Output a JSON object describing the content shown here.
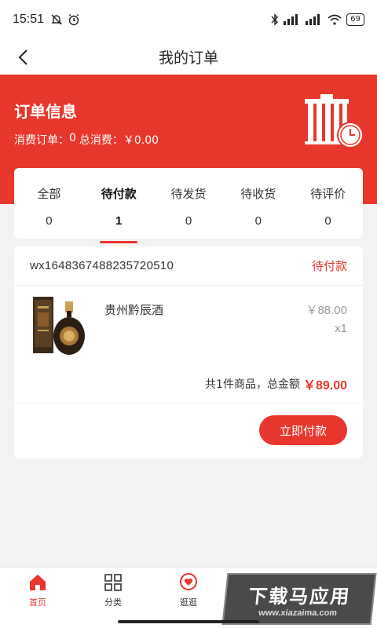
{
  "status_bar": {
    "time": "15:51",
    "battery": "69"
  },
  "nav": {
    "title": "我的订单"
  },
  "header": {
    "title": "订单信息",
    "orders_label": "消费订单：",
    "orders_count": "0",
    "total_label": "总消费：",
    "total_value": "￥0.00"
  },
  "tabs": [
    {
      "label": "全部",
      "count": "0"
    },
    {
      "label": "待付款",
      "count": "1"
    },
    {
      "label": "待发货",
      "count": "0"
    },
    {
      "label": "待收货",
      "count": "0"
    },
    {
      "label": "待评价",
      "count": "0"
    }
  ],
  "order": {
    "number": "wx1648367488235720510",
    "status": "待付款",
    "item": {
      "name": "贵州黔辰酒",
      "price": "￥88.00",
      "qty": "x1"
    },
    "summary_prefix": "共1件商品，总金额",
    "total": "￥89.00",
    "pay_label": "立即付款"
  },
  "bottom_nav": [
    {
      "label": "首页",
      "icon": "home-icon"
    },
    {
      "label": "分类",
      "icon": "grid-icon"
    },
    {
      "label": "逛逛",
      "icon": "heart-bubble-icon"
    },
    {
      "label": "",
      "icon": "cart-icon"
    },
    {
      "label": "",
      "icon": "user-icon"
    }
  ],
  "watermark": {
    "big": "下载马应用",
    "small": "www.xiazaima.com"
  },
  "colors": {
    "accent": "#e8372c",
    "background": "#f3f3f3"
  }
}
